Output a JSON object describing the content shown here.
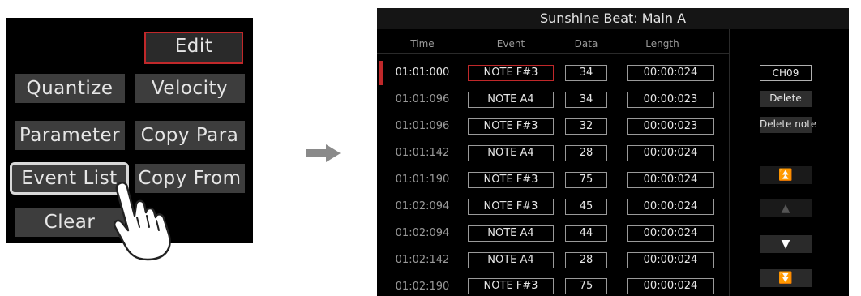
{
  "menu": {
    "edit": "Edit",
    "quantize": "Quantize",
    "velocity": "Velocity",
    "parameter": "Parameter",
    "copy_para": "Copy Para",
    "event_list": "Event List",
    "copy_from": "Copy From",
    "clear": "Clear"
  },
  "event_editor": {
    "title": "Sunshine Beat: Main A",
    "columns": {
      "time": "Time",
      "event": "Event",
      "data": "Data",
      "length": "Length"
    },
    "rows": [
      {
        "time": "01:01:000",
        "event": "NOTE F#3",
        "data": "34",
        "length": "00:00:024"
      },
      {
        "time": "01:01:096",
        "event": "NOTE A4",
        "data": "34",
        "length": "00:00:023"
      },
      {
        "time": "01:01:096",
        "event": "NOTE F#3",
        "data": "32",
        "length": "00:00:023"
      },
      {
        "time": "01:01:142",
        "event": "NOTE A4",
        "data": "28",
        "length": "00:00:024"
      },
      {
        "time": "01:01:190",
        "event": "NOTE F#3",
        "data": "75",
        "length": "00:00:024"
      },
      {
        "time": "01:02:094",
        "event": "NOTE F#3",
        "data": "45",
        "length": "00:00:024"
      },
      {
        "time": "01:02:094",
        "event": "NOTE A4",
        "data": "44",
        "length": "00:00:024"
      },
      {
        "time": "01:02:142",
        "event": "NOTE A4",
        "data": "28",
        "length": "00:00:024"
      },
      {
        "time": "01:02:190",
        "event": "NOTE F#3",
        "data": "75",
        "length": "00:00:024"
      }
    ],
    "side": {
      "channel": "CH09",
      "delete": "Delete",
      "delete_note": "Delete note"
    },
    "nav_icons": [
      "page-up-icon",
      "up-icon",
      "down-icon",
      "page-down-icon"
    ]
  },
  "colors": {
    "accent": "#c0282a",
    "background": "#000000",
    "button": "#3d3d3d"
  }
}
